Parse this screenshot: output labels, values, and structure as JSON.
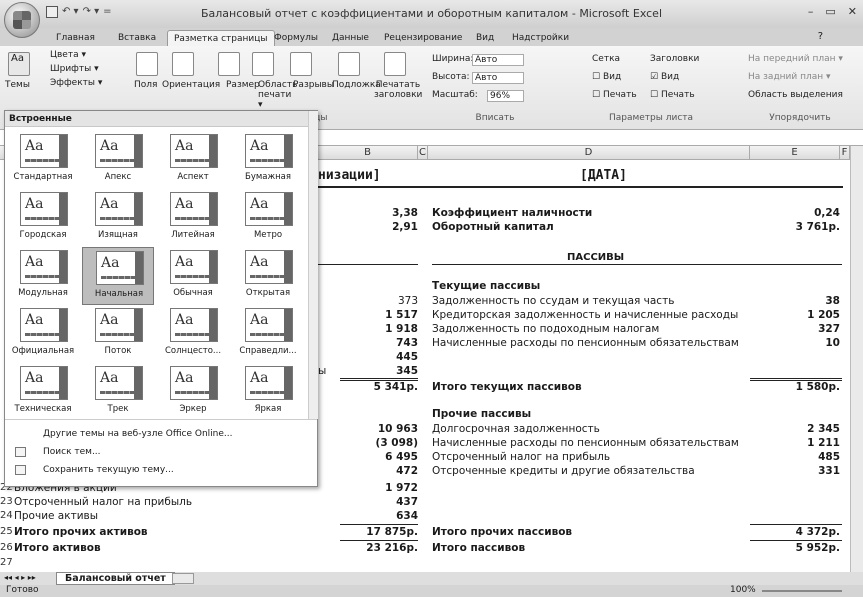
{
  "window": {
    "title": "Балансовый отчет с коэффициентами и оборотным капиталом - Microsoft Excel",
    "controls": [
      "–",
      "▭",
      "✕"
    ]
  },
  "qat": [
    "▾",
    "↶ ▾",
    "↷ ▾",
    "="
  ],
  "tabs": [
    {
      "label": "Главная",
      "active": false
    },
    {
      "label": "Вставка",
      "active": false
    },
    {
      "label": "Разметка страницы",
      "active": true
    },
    {
      "label": "Формулы",
      "active": false
    },
    {
      "label": "Данные",
      "active": false
    },
    {
      "label": "Рецензирование",
      "active": false
    },
    {
      "label": "Вид",
      "active": false
    },
    {
      "label": "Надстройки",
      "active": false
    }
  ],
  "ribbon": {
    "themes": "Темы",
    "colors": "Цвета ▾",
    "fonts": "Шрифты ▾",
    "effects": "Эффекты ▾",
    "fields": "Поля",
    "orientation": "Ориентация",
    "size": "Размер",
    "print_area": "Область печати ▾",
    "breaks": "Разрывы",
    "background": "Подложка",
    "print_titles": "Печатать заголовки",
    "width_label": "Ширина:",
    "width_value": "Авто",
    "height_label": "Высота:",
    "height_value": "Авто",
    "scale_label": "Масштаб:",
    "scale_value": "96%",
    "fit_group": "Вписать",
    "grid": "Сетка",
    "headers": "Заголовки",
    "view": "Вид",
    "print": "Печать",
    "sheet_params": "Параметры листа",
    "bring_front": "На передний план ▾",
    "send_back": "На задний план ▾",
    "selection_pane": "Область выделения",
    "arrange": "Упорядочить",
    "page_params_partial": "ицы"
  },
  "dropdown": {
    "header": "Встроенные",
    "themes": [
      [
        "Стандартная",
        "Апекс",
        "Аспект",
        "Бумажная"
      ],
      [
        "Городская",
        "Изящная",
        "Литейная",
        "Метро"
      ],
      [
        "Модульная",
        "Начальная",
        "Обычная",
        "Открытая"
      ],
      [
        "Официальная",
        "Поток",
        "Солнцесто...",
        "Справедли..."
      ],
      [
        "Техническая",
        "Трек",
        "Эркер",
        "Яркая"
      ]
    ],
    "selected": "Начальная",
    "menu": [
      "Другие темы на веб-узле Office Online...",
      "Поиск тем...",
      "Сохранить текущую тему..."
    ]
  },
  "columns": [
    "B",
    "C",
    "D",
    "E",
    "F"
  ],
  "sheet": {
    "title_left": "низации]",
    "title_right": "[ДАТА]",
    "rows_top": [
      {
        "b": "3,38",
        "d": "Коэффициент наличности",
        "e": "0,24",
        "bold": true
      },
      {
        "b": "2,91",
        "d": "Оборотный капитал",
        "e": "3 761р.",
        "bold": true
      }
    ],
    "liabilities_header": "ПАССИВЫ",
    "current_header": "Текущие пассивы",
    "current": [
      {
        "b": "373",
        "d": "Задолженность по ссудам и текущая часть",
        "e": "38"
      },
      {
        "b": "1 517",
        "d": "Кредиторская задолженность и начисленные расходы",
        "e": "1 205"
      },
      {
        "b": "1 918",
        "d": "Задолженность по подоходным налогам",
        "e": "327"
      },
      {
        "b": "743",
        "d": "Начисленные расходы по пенсионным обязательствам",
        "e": "10"
      },
      {
        "b": "445",
        "d": "",
        "e": ""
      },
      {
        "b": "345",
        "d": "",
        "e": ""
      }
    ],
    "partial_a": "ы",
    "total_current": {
      "b": "5 341р.",
      "d": "Итого текущих пассивов",
      "e": "1 580р."
    },
    "other_header": "Прочие пассивы",
    "other": [
      {
        "b": "10 963",
        "d": "Долгосрочная задолженность",
        "e": "2 345"
      },
      {
        "b": "(3 098)",
        "d": "Начисленные расходы по пенсионным обязательствам",
        "e": "1 211"
      },
      {
        "b": "6 495",
        "d": "Отсроченный налог на прибыль",
        "e": "485"
      },
      {
        "b": "472",
        "d": "Отсроченные кредиты и другие обязательства",
        "e": "331"
      },
      {
        "b": "1 972",
        "d": "",
        "e": ""
      }
    ],
    "rows_bottom": [
      {
        "n": "22",
        "a": "Вложения в акции",
        "b": "1 972"
      },
      {
        "n": "23",
        "a": "Отсроченный налог на прибыль",
        "b": "437"
      },
      {
        "n": "24",
        "a": "Прочие активы",
        "b": "634"
      },
      {
        "n": "25",
        "a": "Итого прочих активов",
        "b": "17 875р.",
        "d": "Итого прочих пассивов",
        "e": "4 372р."
      },
      {
        "n": "26",
        "a": "Итого активов",
        "b": "23 216р.",
        "d": "Итого пассивов",
        "e": "5 952р."
      },
      {
        "n": "27",
        "a": "",
        "b": ""
      }
    ]
  },
  "sheet_tab": "Балансовый отчет",
  "status": {
    "ready": "Готово",
    "zoom": "100%"
  }
}
